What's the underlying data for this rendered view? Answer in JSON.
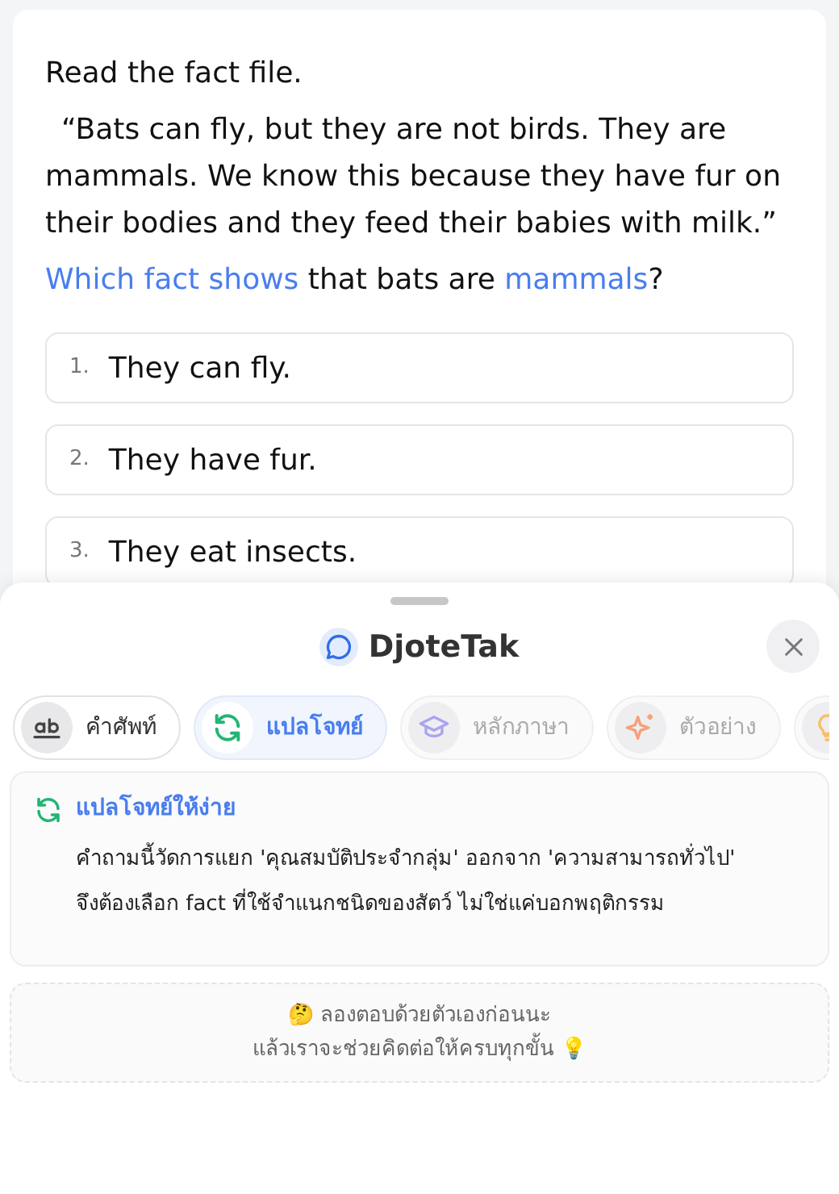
{
  "question_card": {
    "instruction": "Read the fact file.",
    "passage": "“Bats can fly, but they are not birds. They are mammals. We know this because they have fur on their bodies and they feed their babies with milk.”",
    "question": [
      {
        "text": "Which fact shows",
        "highlight": true
      },
      {
        "text": " that bats are ",
        "highlight": false
      },
      {
        "text": "mammals",
        "highlight": true
      },
      {
        "text": "?",
        "highlight": false
      }
    ],
    "options": [
      {
        "number": "1.",
        "text": "They can fly."
      },
      {
        "number": "2.",
        "text": "They have fur."
      },
      {
        "number": "3.",
        "text": "They eat insects."
      }
    ]
  },
  "sheet": {
    "title": "DjoteTak",
    "tabs": [
      {
        "kind": "vocab",
        "label": "คำศัพท์",
        "selected": false,
        "dimmed": false
      },
      {
        "kind": "rephrase",
        "label": "แปลโจทย์",
        "selected": true,
        "dimmed": false
      },
      {
        "kind": "grammar",
        "label": "หลักภาษา",
        "selected": false,
        "dimmed": true
      },
      {
        "kind": "example",
        "label": "ตัวอย่าง",
        "selected": false,
        "dimmed": true
      },
      {
        "kind": "hint",
        "selected": false,
        "dimmed": true
      }
    ],
    "panel": {
      "heading": "แปลโจทย์ให้ง่าย",
      "lines": [
        "คำถามนี้วัดการแยก 'คุณสมบัติประจำกลุ่ม' ออกจาก 'ความสามารถทั่วไป'",
        "จึงต้องเลือก fact ที่ใช้จำแนกชนิดของสัตว์ ไม่ใช่แค่บอกพฤติกรรม"
      ]
    },
    "nudge": [
      "🤔 ลองตอบด้วยตัวเองก่อนนะ",
      "แล้วเราจะช่วยคิดต่อให้ครบทุกขั้น 💡"
    ]
  }
}
